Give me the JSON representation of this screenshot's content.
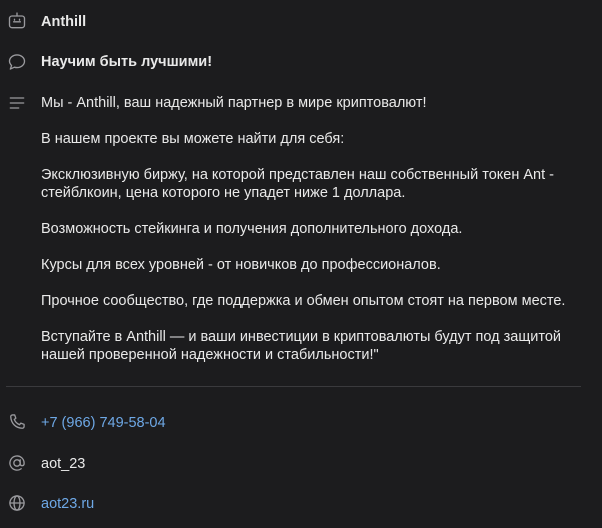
{
  "group": {
    "name": "Anthill",
    "slogan": "Научим быть лучшими!"
  },
  "description": {
    "paragraphs": [
      "Мы - Anthill, ваш надежный партнер в мире криптовалют!",
      "В нашем проекте вы можете найти для себя:",
      "Эксклюзивную биржу, на которой представлен наш собственный токен Ant - стейблкоин, цена которого не упадет ниже 1 доллара.",
      "Возможность стейкинга и получения дополнительного дохода.",
      "Курсы для всех уровней - от новичков до профессионалов.",
      "Прочное сообщество, где поддержка и обмен опытом стоят на первом месте.",
      "Вступайте в Anthill — и ваши инвестиции в криптовалюты будут под защитой нашей проверенной надежности и стабильности!\""
    ]
  },
  "contacts": {
    "phone": "+7 (966) 749-58-04",
    "username": "aot_23",
    "website": "aot23.ru"
  },
  "icons": {
    "name": "bot-icon",
    "slogan": "chat-bubble-icon",
    "description": "lines-icon",
    "phone": "phone-icon",
    "username": "at-sign-icon",
    "website": "globe-icon"
  },
  "colors": {
    "background": "#1c1c1e",
    "text": "#e9e9e9",
    "icon": "#9a9a9e",
    "link": "#6ea8e6",
    "divider": "#3a3a3d"
  }
}
